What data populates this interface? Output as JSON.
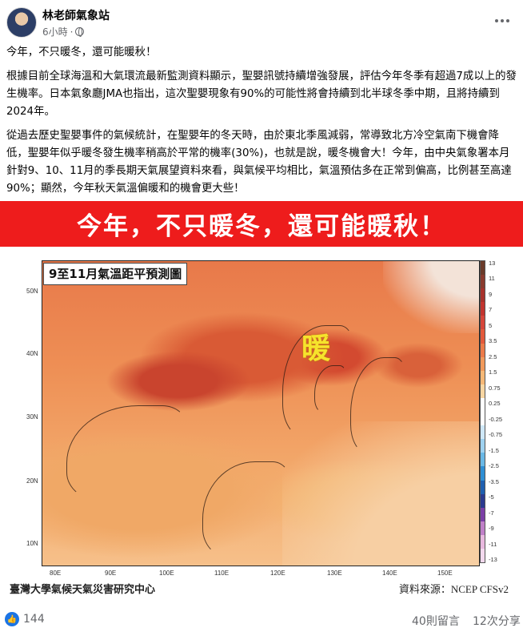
{
  "post": {
    "page_name": "林老師氣象站",
    "time": "6小時",
    "paragraphs": [
      "今年，不只暖冬，還可能暖秋！",
      "根據目前全球海溫和大氣環流最新監測資料顯示，聖嬰訊號持續增強發展，評估今年冬季有超過7成以上的發生機率。日本氣象廳JMA也指出，這次聖嬰現象有90%的可能性將會持續到北半球冬季中期，且將持續到2024年。",
      "從過去歷史聖嬰事件的氣候統計，在聖嬰年的冬天時，由於東北季風減弱，常導致北方冷空氣南下機會降低，聖嬰年似乎暖冬發生機率稍高於平常的機率(30%)，也就是說，暖冬機會大！今年，由中央氣象署本月針對9、10、11月的季長期天氣展望資料來看，與氣候平均相比，氣溫預估多在正常到偏高，比例甚至高達90%；顯然，今年秋天氣溫偏暖和的機會更大些！"
    ]
  },
  "image": {
    "banner": "今年，不只暖冬，還可能暖秋！",
    "map_title": "9至11月氣溫距平預測圖",
    "warm_label": "暖",
    "lat_labels": [
      "50N",
      "40N",
      "30N",
      "20N",
      "10N"
    ],
    "lon_labels": [
      "80E",
      "90E",
      "100E",
      "110E",
      "120E",
      "130E",
      "140E",
      "150E"
    ],
    "legend_ticks": [
      "13",
      "11",
      "9",
      "7",
      "5",
      "3.5",
      "2.5",
      "1.5",
      "0.75",
      "0.25",
      "-0.25",
      "-0.75",
      "-1.5",
      "-2.5",
      "-3.5",
      "-5",
      "-7",
      "-9",
      "-11",
      "-13"
    ],
    "legend_colors": [
      "#6b3b2a",
      "#8a3b2e",
      "#a8322c",
      "#c2352f",
      "#d6463a",
      "#e35a3c",
      "#ec7b4a",
      "#f19a5c",
      "#f5b877",
      "#f8d6a2",
      "#ffffff",
      "#ffffff",
      "#cfe8f7",
      "#9fd2f0",
      "#6ab8e6",
      "#2f8fd4",
      "#1f5fb0",
      "#2b3a8f",
      "#7b3fa6",
      "#c080c8",
      "#e8b8de",
      "#f3d9ee"
    ],
    "credit_left": "臺灣大學氣候天氣災害研究中心",
    "credit_right": "資料來源：NCEP CFSv2"
  },
  "footer": {
    "likes": "144",
    "comments": "40則留言",
    "shares": "12次分享"
  }
}
